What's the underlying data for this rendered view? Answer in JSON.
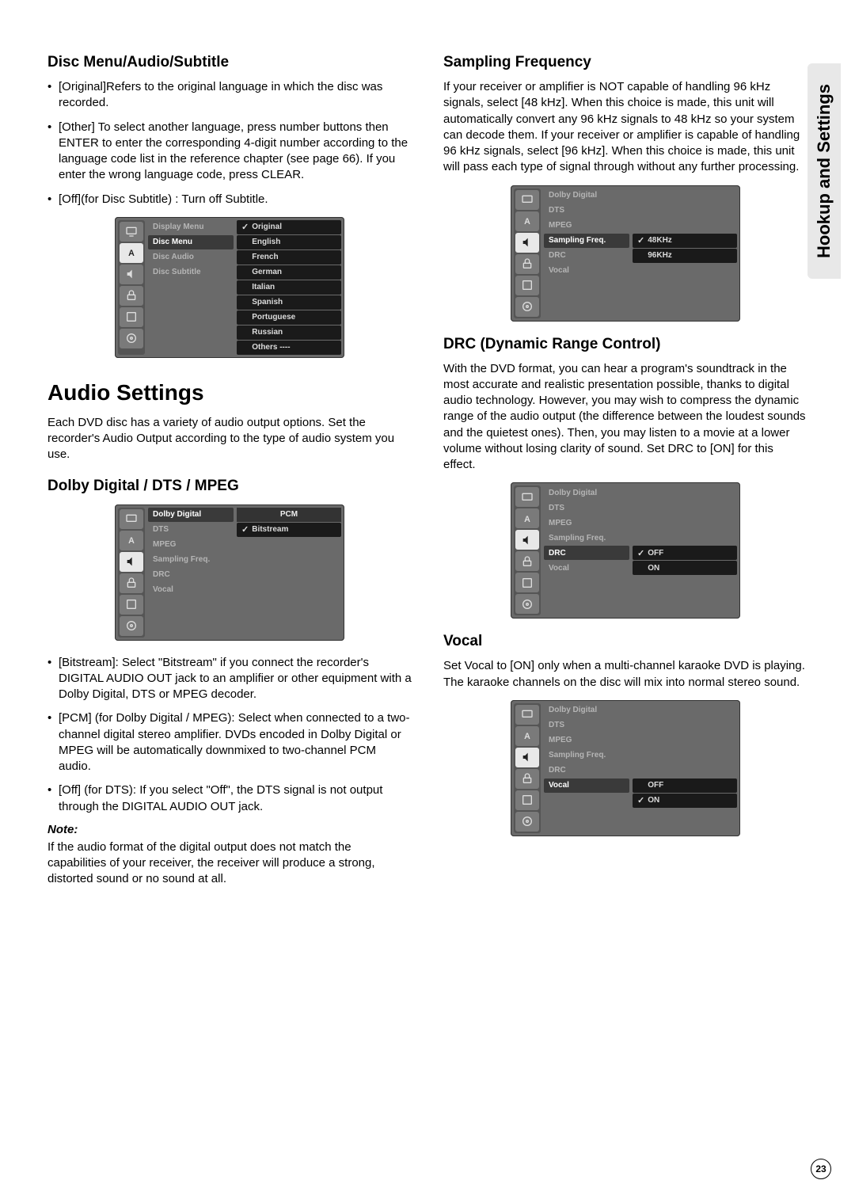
{
  "side_tab": "Hookup and Settings",
  "page_number": "23",
  "left": {
    "h_disc": "Disc Menu/Audio/Subtitle",
    "bullets1": [
      "[Original]Refers to the original language in which the disc was recorded.",
      "[Other] To select another language, press number buttons then ENTER to enter the corresponding 4-digit number according to the language code list in the reference chapter (see page 66). If you enter the wrong language code, press CLEAR.",
      "[Off](for Disc Subtitle) : Turn off Subtitle."
    ],
    "h_audio_settings": "Audio Settings",
    "p_audio_settings": "Each DVD disc has a variety of audio output options. Set the recorder's Audio Output according to the type of audio system you use.",
    "h_dolby": "Dolby Digital / DTS / MPEG",
    "bullets2": [
      "[Bitstream]: Select \"Bitstream\" if you connect the recorder's DIGITAL AUDIO OUT jack to an amplifier or other equipment with a Dolby Digital, DTS or MPEG decoder.",
      "[PCM] (for Dolby Digital / MPEG): Select when connected to a two-channel digital stereo amplifier. DVDs encoded in Dolby Digital or MPEG will be automatically downmixed to two-channel PCM audio.",
      "[Off] (for DTS): If you select \"Off\", the DTS signal is not output through the DIGITAL AUDIO OUT jack."
    ],
    "note_label": "Note:",
    "note_body": "If the audio format of the digital output does not match the capabilities of your receiver, the receiver will produce a strong, distorted sound or no sound at all."
  },
  "right": {
    "h_sampling": "Sampling Frequency",
    "p_sampling": "If your receiver or amplifier is NOT capable of handling 96 kHz signals, select [48 kHz]. When this choice is made, this unit will automatically convert any 96 kHz signals to 48 kHz so your system can decode them. If your receiver or amplifier is capable of handling 96 kHz signals, select [96 kHz]. When this choice is made, this unit will pass each type of signal through without any further processing.",
    "h_drc": "DRC (Dynamic Range Control)",
    "p_drc": "With the DVD format, you can hear a program's soundtrack in the most accurate and realistic presentation possible, thanks to digital audio technology. However, you may wish to compress the dynamic range of the audio output (the difference between the loudest sounds and the quietest ones). Then, you may listen to a movie at a lower volume without losing clarity of sound. Set DRC to [ON] for this effect.",
    "h_vocal": "Vocal",
    "p_vocal": "Set Vocal to [ON] only when a multi-channel karaoke DVD is playing. The karaoke channels on the disc will mix into normal stereo sound."
  },
  "osd": {
    "mid_lang": [
      "Display Menu",
      "Disc Menu",
      "Disc Audio",
      "Disc Subtitle"
    ],
    "right_lang": [
      "Original",
      "English",
      "French",
      "German",
      "Italian",
      "Spanish",
      "Portuguese",
      "Russian",
      "Others    ----"
    ],
    "mid_audio": [
      "Dolby Digital",
      "DTS",
      "MPEG",
      "Sampling Freq.",
      "DRC",
      "Vocal"
    ],
    "dolby_header": "PCM",
    "dolby_opts": [
      "Bitstream"
    ],
    "samp_opts": [
      "48KHz",
      "96KHz"
    ],
    "drc_opts": [
      "OFF",
      "ON"
    ],
    "vocal_opts": [
      "OFF",
      "ON"
    ]
  }
}
